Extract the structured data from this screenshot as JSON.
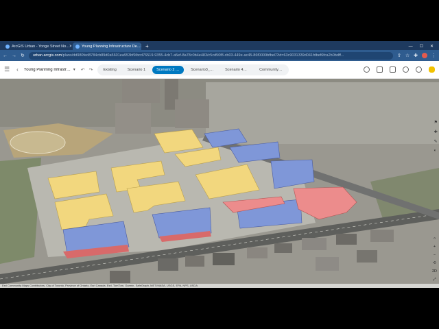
{
  "browser": {
    "tabs": [
      {
        "title": "ArcGIS Urban - Yonge Street No...",
        "active": false
      },
      {
        "title": "Young Planning Infrastructure De...",
        "active": true
      }
    ],
    "new_tab": "+",
    "url_host": "urban.arcgis.com",
    "url_path": "/plans/dd980fed8784cb89d0a5601ea953bf9/bcd76519-9355-4cb7-a5ef-8a78c0b4e483/c5cd50f8-cb03-449e-ac45-86f0009bfbe0?id=63c9031339d041fdbef6fca2b0bdff...",
    "window_controls": [
      "—",
      "☐",
      "✕"
    ]
  },
  "app": {
    "plan_title": "Young Planning Infrastruct...",
    "scenarios": [
      {
        "label": "Existing",
        "active": false
      },
      {
        "label": "Scenario 1",
        "active": false
      },
      {
        "label": "Scenario 2 - B*",
        "active": true
      },
      {
        "label": "Scenario3_Te...",
        "active": false
      },
      {
        "label": "Scenario 4_S...",
        "active": false
      },
      {
        "label": "Community &...",
        "active": false
      }
    ]
  },
  "map": {
    "side_tools": [
      "⚑",
      "✚",
      "✎",
      "◐"
    ],
    "nav": [
      "⌂",
      "+",
      "−",
      "⟲",
      "2D",
      "⤢"
    ],
    "attribution": "Esri Community Maps Contributors, City of Toronto, Province of Ontario, Esri Canada, Esri, TomTom, Garmin, SafeGraph, METI/NASA, USGS, EPA, NPS, USDA"
  },
  "colors": {
    "residential": "#f2d77e",
    "commercial": "#7f97d8",
    "retail": "#ec8c8c",
    "accent": "#0079c1"
  }
}
